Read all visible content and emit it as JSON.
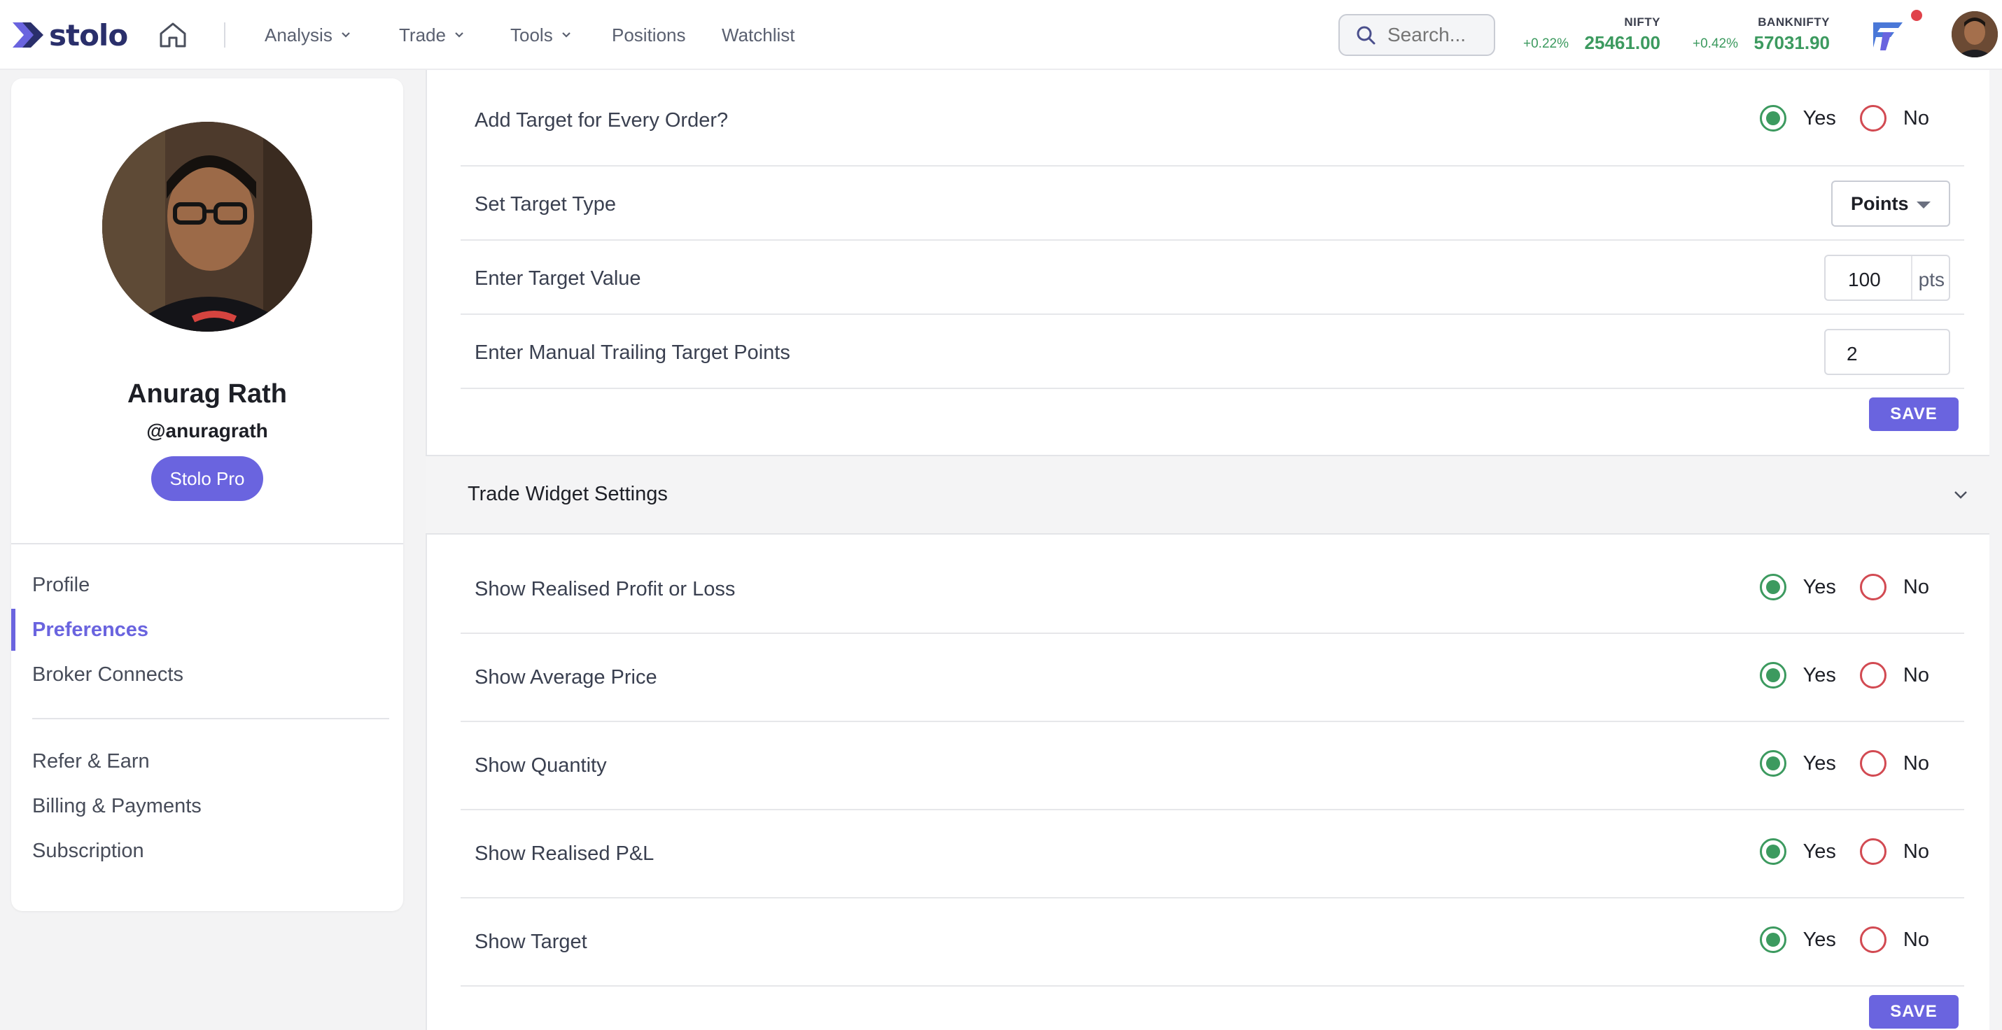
{
  "brand": {
    "name": "stolo",
    "accent": "#6a64df",
    "green": "#3c9a5f",
    "red": "#d24a52"
  },
  "nav": {
    "items": [
      {
        "label": "Analysis",
        "dropdown": true
      },
      {
        "label": "Trade",
        "dropdown": true
      },
      {
        "label": "Tools",
        "dropdown": true
      },
      {
        "label": "Positions",
        "dropdown": false
      },
      {
        "label": "Watchlist",
        "dropdown": false
      }
    ],
    "search_placeholder": "Search..."
  },
  "tickers": [
    {
      "name": "NIFTY",
      "change": "+0.22%",
      "value": "25461.00"
    },
    {
      "name": "BANKNIFTY",
      "change": "+0.42%",
      "value": "57031.90"
    }
  ],
  "profile": {
    "name": "Anurag Rath",
    "handle": "@anuragrath",
    "plan": "Stolo Pro"
  },
  "sidebar": {
    "items": [
      {
        "label": "Profile"
      },
      {
        "label": "Preferences"
      },
      {
        "label": "Broker Connects"
      }
    ],
    "items2": [
      {
        "label": "Refer & Earn"
      },
      {
        "label": "Billing & Payments"
      },
      {
        "label": "Subscription"
      }
    ]
  },
  "target_settings": {
    "add_target": {
      "label": "Add Target for Every Order?",
      "value": "Yes"
    },
    "target_type": {
      "label": "Set Target Type",
      "value": "Points"
    },
    "target_value": {
      "label": "Enter Target Value",
      "value": "100",
      "unit": "pts"
    },
    "trailing": {
      "label": "Enter Manual Trailing Target Points",
      "value": "2"
    },
    "save": "SAVE"
  },
  "trade_widget": {
    "title": "Trade Widget Settings",
    "rows": [
      {
        "label": "Show Realised Profit or Loss",
        "value": "Yes"
      },
      {
        "label": "Show Average Price",
        "value": "Yes"
      },
      {
        "label": "Show Quantity",
        "value": "Yes"
      },
      {
        "label": "Show Realised P&L",
        "value": "Yes"
      },
      {
        "label": "Show Target",
        "value": "Yes"
      }
    ],
    "save": "SAVE"
  },
  "options": {
    "yes": "Yes",
    "no": "No"
  }
}
